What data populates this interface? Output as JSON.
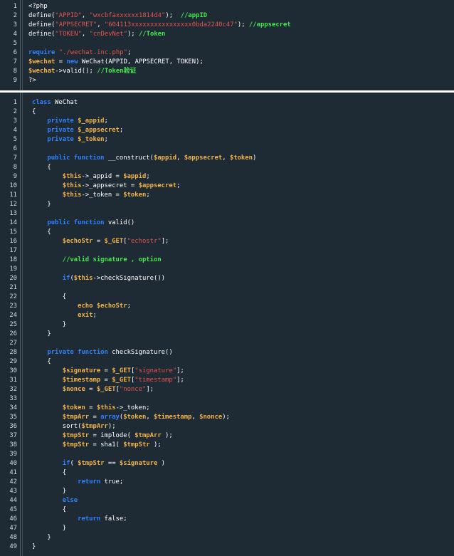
{
  "snippet_top": {
    "lines": [
      {
        "n": "1",
        "tokens": [
          [
            "p",
            "<?php"
          ]
        ]
      },
      {
        "n": "2",
        "tokens": [
          [
            "p",
            "define("
          ],
          [
            "s",
            "\"APPID\""
          ],
          [
            "p",
            ", "
          ],
          [
            "s",
            "\"wxcbfaxxxxxx1814d4\""
          ],
          [
            "p",
            ");  "
          ],
          [
            "c",
            "//appID"
          ]
        ]
      },
      {
        "n": "3",
        "tokens": [
          [
            "p",
            "define("
          ],
          [
            "s",
            "\"APPSECRET\""
          ],
          [
            "p",
            ", "
          ],
          [
            "s",
            "\"604113xxxxxxxxxxxxxxxx0bda2240c47\""
          ],
          [
            "p",
            "); "
          ],
          [
            "c",
            "//appsecret"
          ]
        ]
      },
      {
        "n": "4",
        "tokens": [
          [
            "p",
            "define("
          ],
          [
            "s",
            "\"TOKEN\""
          ],
          [
            "p",
            ", "
          ],
          [
            "s",
            "\"cnDevNet\""
          ],
          [
            "p",
            "); "
          ],
          [
            "c",
            "//Token"
          ]
        ]
      },
      {
        "n": "5",
        "tokens": []
      },
      {
        "n": "6",
        "tokens": [
          [
            "k",
            "require"
          ],
          [
            "p",
            " "
          ],
          [
            "s",
            "\"./wechat.inc.php\""
          ],
          [
            "p",
            ";"
          ]
        ]
      },
      {
        "n": "7",
        "tokens": [
          [
            "v",
            "$wechat"
          ],
          [
            "p",
            " = "
          ],
          [
            "k",
            "new"
          ],
          [
            "p",
            " WeChat(APPID, APPSECRET, TOKEN);"
          ]
        ]
      },
      {
        "n": "8",
        "tokens": [
          [
            "v",
            "$wechat"
          ],
          [
            "p",
            "->valid(); "
          ],
          [
            "c",
            "//Token验证"
          ]
        ]
      },
      {
        "n": "9",
        "tokens": [
          [
            "p",
            "?>"
          ]
        ]
      }
    ]
  },
  "snippet_bottom": {
    "lines": [
      {
        "n": "1",
        "tokens": [
          [
            "k",
            "class"
          ],
          [
            "p",
            " WeChat"
          ]
        ]
      },
      {
        "n": "2",
        "tokens": [
          [
            "p",
            "{"
          ]
        ]
      },
      {
        "n": "3",
        "tokens": [
          [
            "p",
            "    "
          ],
          [
            "k",
            "private"
          ],
          [
            "p",
            " "
          ],
          [
            "v",
            "$_appid"
          ],
          [
            "p",
            ";"
          ]
        ]
      },
      {
        "n": "4",
        "tokens": [
          [
            "p",
            "    "
          ],
          [
            "k",
            "private"
          ],
          [
            "p",
            " "
          ],
          [
            "v",
            "$_appsecret"
          ],
          [
            "p",
            ";"
          ]
        ]
      },
      {
        "n": "5",
        "tokens": [
          [
            "p",
            "    "
          ],
          [
            "k",
            "private"
          ],
          [
            "p",
            " "
          ],
          [
            "v",
            "$_token"
          ],
          [
            "p",
            ";"
          ]
        ]
      },
      {
        "n": "6",
        "tokens": []
      },
      {
        "n": "7",
        "tokens": [
          [
            "p",
            "    "
          ],
          [
            "k",
            "public"
          ],
          [
            "p",
            " "
          ],
          [
            "k",
            "function"
          ],
          [
            "p",
            " __construct("
          ],
          [
            "v",
            "$appid"
          ],
          [
            "p",
            ", "
          ],
          [
            "v",
            "$appsecret"
          ],
          [
            "p",
            ", "
          ],
          [
            "v",
            "$token"
          ],
          [
            "p",
            ")"
          ]
        ]
      },
      {
        "n": "8",
        "tokens": [
          [
            "p",
            "    {"
          ]
        ]
      },
      {
        "n": "9",
        "tokens": [
          [
            "p",
            "        "
          ],
          [
            "v",
            "$this"
          ],
          [
            "p",
            "->_appid = "
          ],
          [
            "v",
            "$appid"
          ],
          [
            "p",
            ";"
          ]
        ]
      },
      {
        "n": "10",
        "tokens": [
          [
            "p",
            "        "
          ],
          [
            "v",
            "$this"
          ],
          [
            "p",
            "->_appsecret = "
          ],
          [
            "v",
            "$appsecret"
          ],
          [
            "p",
            ";"
          ]
        ]
      },
      {
        "n": "11",
        "tokens": [
          [
            "p",
            "        "
          ],
          [
            "v",
            "$this"
          ],
          [
            "p",
            "->_token = "
          ],
          [
            "v",
            "$token"
          ],
          [
            "p",
            ";"
          ]
        ]
      },
      {
        "n": "12",
        "tokens": [
          [
            "p",
            "    }"
          ]
        ]
      },
      {
        "n": "13",
        "tokens": []
      },
      {
        "n": "14",
        "tokens": [
          [
            "p",
            "    "
          ],
          [
            "k",
            "public"
          ],
          [
            "p",
            " "
          ],
          [
            "k",
            "function"
          ],
          [
            "p",
            " valid()"
          ]
        ]
      },
      {
        "n": "15",
        "tokens": [
          [
            "p",
            "    {"
          ]
        ]
      },
      {
        "n": "16",
        "tokens": [
          [
            "p",
            "        "
          ],
          [
            "v",
            "$echoStr"
          ],
          [
            "p",
            " = "
          ],
          [
            "v",
            "$_GET"
          ],
          [
            "p",
            "["
          ],
          [
            "s",
            "\"echostr\""
          ],
          [
            "p",
            "];"
          ]
        ]
      },
      {
        "n": "17",
        "tokens": []
      },
      {
        "n": "18",
        "tokens": [
          [
            "p",
            "        "
          ],
          [
            "c",
            "//valid signature , option"
          ]
        ]
      },
      {
        "n": "19",
        "tokens": []
      },
      {
        "n": "20",
        "tokens": [
          [
            "p",
            "        "
          ],
          [
            "k",
            "if"
          ],
          [
            "p",
            "("
          ],
          [
            "v",
            "$this"
          ],
          [
            "p",
            "->checkSignature())"
          ]
        ]
      },
      {
        "n": "21",
        "tokens": []
      },
      {
        "n": "22",
        "tokens": [
          [
            "p",
            "        {"
          ]
        ]
      },
      {
        "n": "23",
        "tokens": [
          [
            "p",
            "            "
          ],
          [
            "v",
            "echo $echoStr"
          ],
          [
            "p",
            ";"
          ]
        ]
      },
      {
        "n": "24",
        "tokens": [
          [
            "p",
            "            "
          ],
          [
            "v",
            "exit"
          ],
          [
            "p",
            ";"
          ]
        ]
      },
      {
        "n": "25",
        "tokens": [
          [
            "p",
            "        }"
          ]
        ]
      },
      {
        "n": "26",
        "tokens": [
          [
            "p",
            "    }"
          ]
        ]
      },
      {
        "n": "27",
        "tokens": []
      },
      {
        "n": "28",
        "tokens": [
          [
            "p",
            "    "
          ],
          [
            "k",
            "private"
          ],
          [
            "p",
            " "
          ],
          [
            "k",
            "function"
          ],
          [
            "p",
            " checkSignature()"
          ]
        ]
      },
      {
        "n": "29",
        "tokens": [
          [
            "p",
            "    {"
          ]
        ]
      },
      {
        "n": "30",
        "tokens": [
          [
            "p",
            "        "
          ],
          [
            "v",
            "$signature"
          ],
          [
            "p",
            " = "
          ],
          [
            "v",
            "$_GET"
          ],
          [
            "p",
            "["
          ],
          [
            "s",
            "\"signature\""
          ],
          [
            "p",
            "];"
          ]
        ]
      },
      {
        "n": "31",
        "tokens": [
          [
            "p",
            "        "
          ],
          [
            "v",
            "$timestamp"
          ],
          [
            "p",
            " = "
          ],
          [
            "v",
            "$_GET"
          ],
          [
            "p",
            "["
          ],
          [
            "s",
            "\"timestamp\""
          ],
          [
            "p",
            "];"
          ]
        ]
      },
      {
        "n": "32",
        "tokens": [
          [
            "p",
            "        "
          ],
          [
            "v",
            "$nonce"
          ],
          [
            "p",
            " = "
          ],
          [
            "v",
            "$_GET"
          ],
          [
            "p",
            "["
          ],
          [
            "s",
            "\"nonce\""
          ],
          [
            "p",
            "];"
          ]
        ]
      },
      {
        "n": "33",
        "tokens": []
      },
      {
        "n": "34",
        "tokens": [
          [
            "p",
            "        "
          ],
          [
            "v",
            "$token"
          ],
          [
            "p",
            " = "
          ],
          [
            "v",
            "$this"
          ],
          [
            "p",
            "->_token;"
          ]
        ]
      },
      {
        "n": "35",
        "tokens": [
          [
            "p",
            "        "
          ],
          [
            "v",
            "$tmpArr"
          ],
          [
            "p",
            " = "
          ],
          [
            "k",
            "array"
          ],
          [
            "p",
            "("
          ],
          [
            "v",
            "$token"
          ],
          [
            "p",
            ", "
          ],
          [
            "v",
            "$timestamp"
          ],
          [
            "p",
            ", "
          ],
          [
            "v",
            "$nonce"
          ],
          [
            "p",
            ");"
          ]
        ]
      },
      {
        "n": "36",
        "tokens": [
          [
            "p",
            "        sort("
          ],
          [
            "v",
            "$tmpArr"
          ],
          [
            "p",
            ");"
          ]
        ]
      },
      {
        "n": "37",
        "tokens": [
          [
            "p",
            "        "
          ],
          [
            "v",
            "$tmpStr"
          ],
          [
            "p",
            " = implode( "
          ],
          [
            "v",
            "$tmpArr"
          ],
          [
            "p",
            " );"
          ]
        ]
      },
      {
        "n": "38",
        "tokens": [
          [
            "p",
            "        "
          ],
          [
            "v",
            "$tmpStr"
          ],
          [
            "p",
            " = sha1( "
          ],
          [
            "v",
            "$tmpStr"
          ],
          [
            "p",
            " );"
          ]
        ]
      },
      {
        "n": "39",
        "tokens": []
      },
      {
        "n": "40",
        "tokens": [
          [
            "p",
            "        "
          ],
          [
            "k",
            "if"
          ],
          [
            "p",
            "( "
          ],
          [
            "v",
            "$tmpStr"
          ],
          [
            "p",
            " == "
          ],
          [
            "v",
            "$signature"
          ],
          [
            "p",
            " )"
          ]
        ]
      },
      {
        "n": "41",
        "tokens": [
          [
            "p",
            "        {"
          ]
        ]
      },
      {
        "n": "42",
        "tokens": [
          [
            "p",
            "            "
          ],
          [
            "k",
            "return"
          ],
          [
            "p",
            " true;"
          ]
        ]
      },
      {
        "n": "43",
        "tokens": [
          [
            "p",
            "        }"
          ]
        ]
      },
      {
        "n": "44",
        "tokens": [
          [
            "p",
            "        "
          ],
          [
            "k",
            "else"
          ]
        ]
      },
      {
        "n": "45",
        "tokens": [
          [
            "p",
            "        {"
          ]
        ]
      },
      {
        "n": "46",
        "tokens": [
          [
            "p",
            "            "
          ],
          [
            "k",
            "return"
          ],
          [
            "p",
            " false;"
          ]
        ]
      },
      {
        "n": "47",
        "tokens": [
          [
            "p",
            "        }"
          ]
        ]
      },
      {
        "n": "48",
        "tokens": [
          [
            "p",
            "    }"
          ]
        ]
      },
      {
        "n": "49",
        "tokens": [
          [
            "p",
            "}"
          ]
        ]
      }
    ]
  },
  "colors": {
    "background": "#1e2a34",
    "keyword": "#2f82ff",
    "variable": "#f3b34a",
    "string": "#e2554e",
    "comment": "#46e84e",
    "plain": "#ffffff",
    "line_number": "#d3dbe2"
  }
}
